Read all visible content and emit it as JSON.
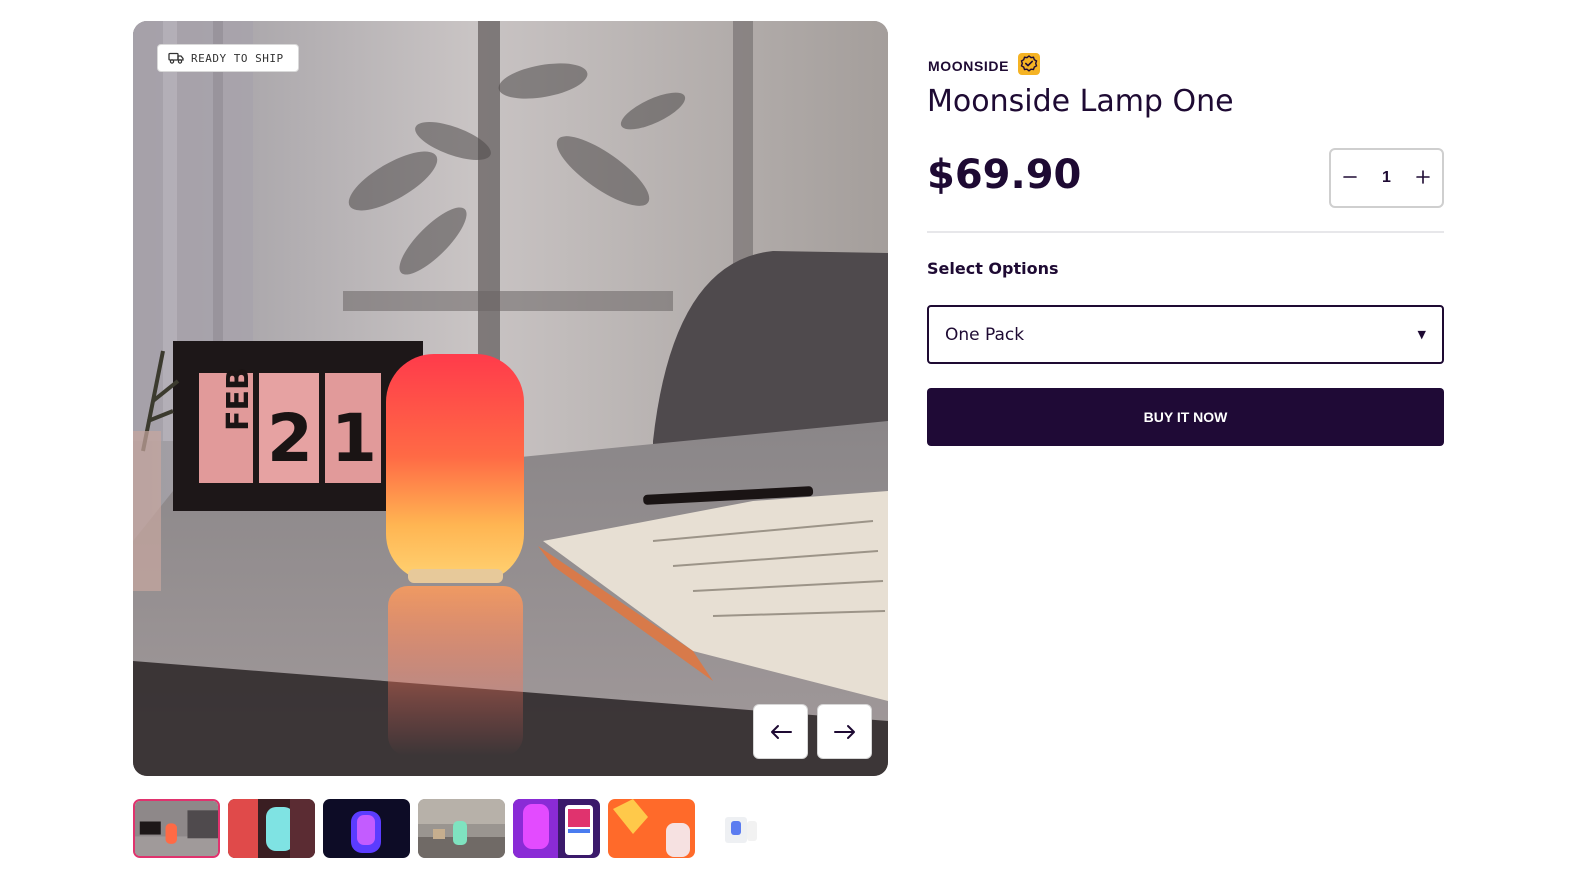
{
  "gallery": {
    "badge": {
      "label": "READY TO SHIP",
      "icon": "truck-icon"
    },
    "main_image_alt": "Moonside Lamp One",
    "prev_icon": "arrow-left-icon",
    "next_icon": "arrow-right-icon",
    "thumbnails": [
      {
        "name": "thumbnail-1",
        "active": true
      },
      {
        "name": "thumbnail-2",
        "active": false
      },
      {
        "name": "thumbnail-3",
        "active": false
      },
      {
        "name": "thumbnail-4",
        "active": false
      },
      {
        "name": "thumbnail-5",
        "active": false
      },
      {
        "name": "thumbnail-6",
        "active": false
      },
      {
        "name": "thumbnail-7",
        "active": false
      }
    ]
  },
  "product": {
    "brand": "MOONSIDE",
    "verified_icon": "verified-badge-icon",
    "title": "Moonside Lamp One",
    "price": "$69.90",
    "quantity": "1",
    "options_label": "Select Options",
    "selected_option": "One Pack",
    "buy_label": "BUY IT NOW"
  },
  "colors": {
    "text": "#1e0a33",
    "button_bg": "#1f0a36",
    "active_thumb_border": "#e0336e",
    "verified_badge": "#f5b324"
  }
}
